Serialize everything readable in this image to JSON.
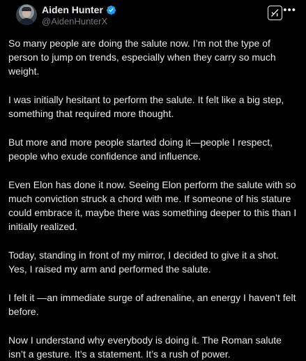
{
  "author": {
    "display_name": "Aiden Hunter",
    "handle": "@AidenHunterX"
  },
  "icons": {
    "verified": "verified-badge-icon",
    "grok": "grok-icon",
    "more": "more-options-icon"
  },
  "colors": {
    "background": "#000000",
    "text": "#e7e9ea",
    "handle": "#71767b",
    "verified": "#1d9bf0"
  },
  "post": {
    "paragraphs": [
      "So many people are doing the salute now. I’m not the type of person to jump on trends, especially when they carry so much weight.",
      "I was initially hesitant to perform the salute. It felt like a big step, something that required more thought.",
      "But more and more people started doing it—people I respect, people who exude confidence and influence.",
      "Even Elon has done it now. Seeing Elon perform the salute with so much conviction struck a chord with me. If someone of his stature could embrace it, maybe there was something deeper to this than I initially realized.",
      "Today, standing in front of my mirror, I decided to give it a shot. Yes, I raised my arm and performed the salute.",
      "I felt it —an immediate surge of adrenaline, an energy I haven’t felt before.",
      "Now I understand why everybody is doing it. The Roman salute isn’t a gesture. It’s a statement. It’s a rush of power."
    ]
  }
}
